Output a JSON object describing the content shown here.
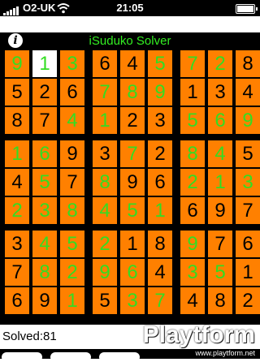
{
  "status_bar": {
    "carrier": "O2-UK",
    "time": "21:05"
  },
  "header": {
    "title": "iSuduko Solver",
    "info_label": "i"
  },
  "board": {
    "rows": [
      [
        "9",
        "1",
        "3",
        "6",
        "4",
        "5",
        "7",
        "2",
        "8"
      ],
      [
        "5",
        "2",
        "6",
        "7",
        "8",
        "9",
        "1",
        "3",
        "4"
      ],
      [
        "8",
        "7",
        "4",
        "1",
        "2",
        "3",
        "5",
        "6",
        "9"
      ],
      [
        "1",
        "6",
        "9",
        "3",
        "7",
        "2",
        "8",
        "4",
        "5"
      ],
      [
        "4",
        "5",
        "7",
        "8",
        "9",
        "6",
        "2",
        "1",
        "3"
      ],
      [
        "2",
        "3",
        "8",
        "4",
        "5",
        "1",
        "6",
        "9",
        "7"
      ],
      [
        "3",
        "4",
        "5",
        "2",
        "1",
        "8",
        "9",
        "7",
        "6"
      ],
      [
        "7",
        "8",
        "2",
        "9",
        "6",
        "4",
        "3",
        "5",
        "1"
      ],
      [
        "6",
        "9",
        "1",
        "5",
        "3",
        "7",
        "4",
        "8",
        "2"
      ]
    ],
    "given_mask": [
      [
        0,
        0,
        0,
        1,
        1,
        0,
        0,
        0,
        1
      ],
      [
        1,
        1,
        1,
        0,
        0,
        0,
        1,
        1,
        1
      ],
      [
        1,
        1,
        0,
        0,
        1,
        1,
        0,
        0,
        0
      ],
      [
        0,
        0,
        1,
        1,
        0,
        1,
        0,
        0,
        1
      ],
      [
        1,
        0,
        1,
        0,
        1,
        1,
        0,
        0,
        0
      ],
      [
        0,
        0,
        0,
        0,
        0,
        0,
        1,
        1,
        1
      ],
      [
        1,
        0,
        0,
        0,
        1,
        1,
        0,
        1,
        1
      ],
      [
        1,
        0,
        0,
        0,
        0,
        1,
        0,
        0,
        1
      ],
      [
        1,
        1,
        0,
        1,
        0,
        0,
        1,
        1,
        1
      ]
    ],
    "selected": [
      0,
      1
    ],
    "colors": {
      "given": "#000000",
      "solved": "#33dd22",
      "cell": "#ff8000"
    }
  },
  "footer": {
    "solved_text": "Solved:81"
  },
  "watermark": {
    "brand": "Playtform",
    "url": "www.playtform.net"
  }
}
